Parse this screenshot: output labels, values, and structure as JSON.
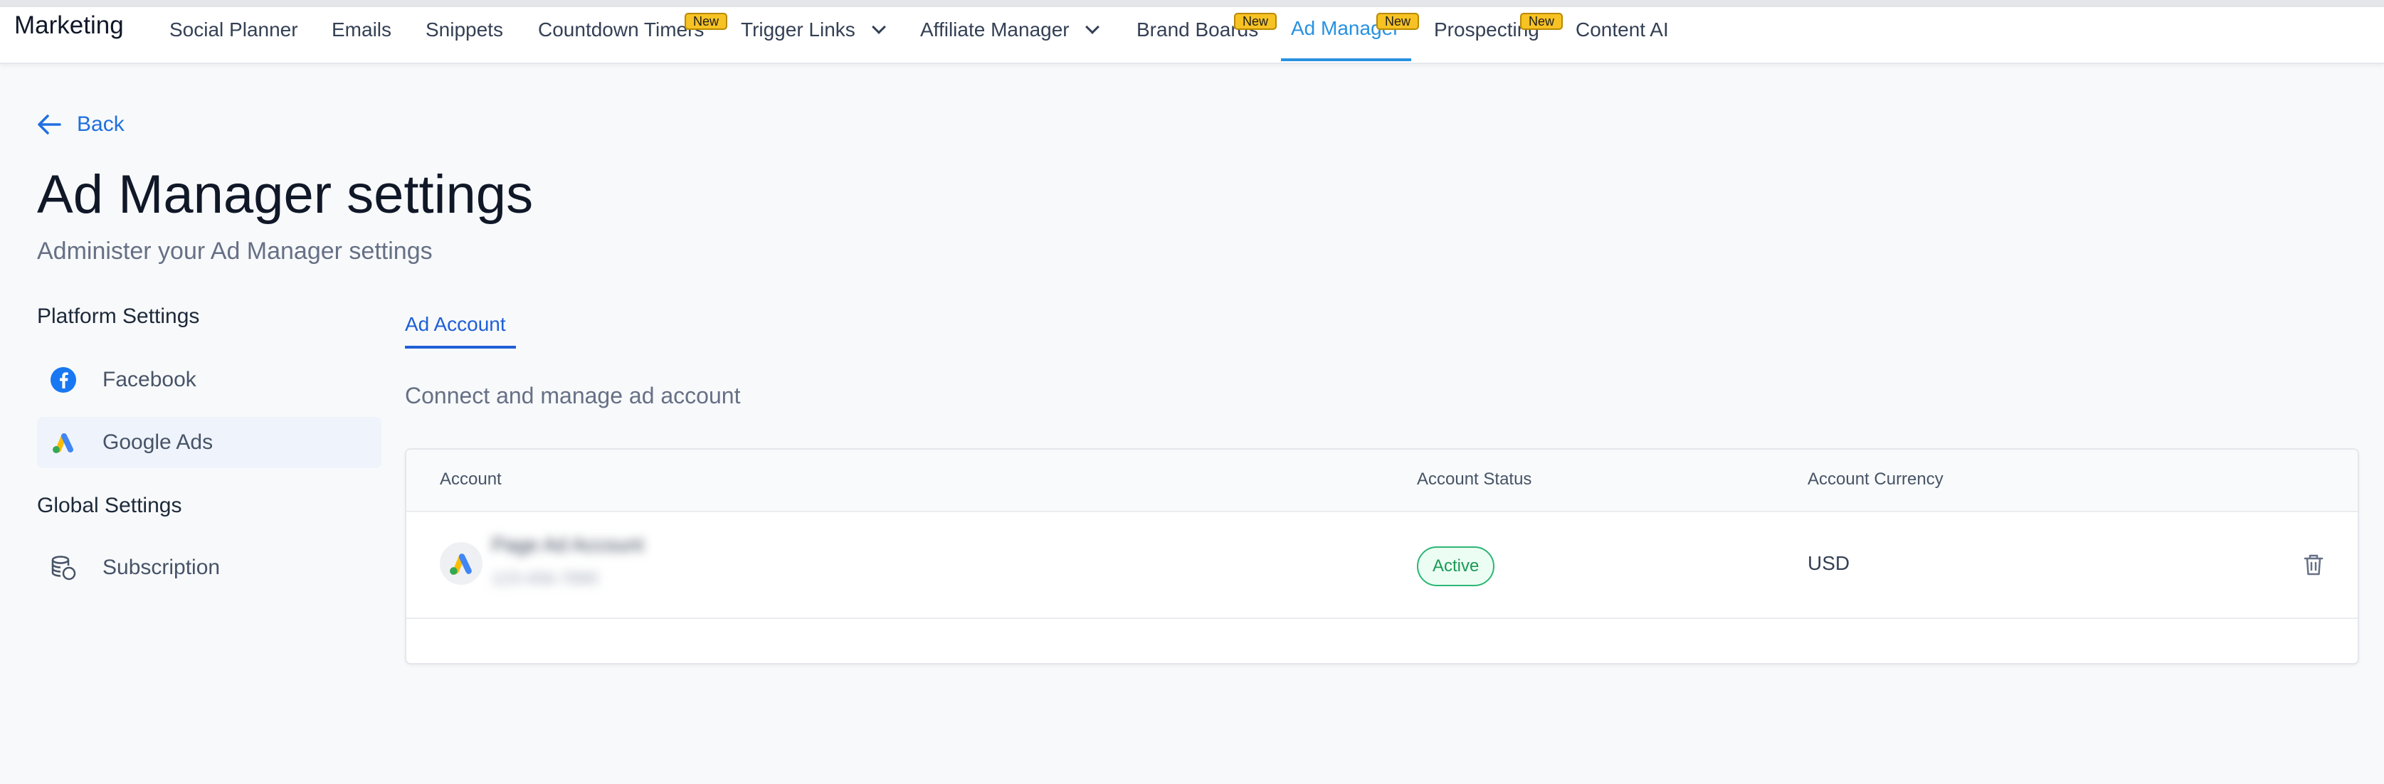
{
  "nav": {
    "brand": "Marketing",
    "items": [
      {
        "label": "Social Planner"
      },
      {
        "label": "Emails"
      },
      {
        "label": "Snippets"
      },
      {
        "label": "Countdown Timers",
        "badge": "New"
      },
      {
        "label": "Trigger Links"
      },
      {
        "label": "Affiliate Manager"
      },
      {
        "label": "Brand Boards",
        "badge": "New"
      },
      {
        "label": "Ad Manager",
        "badge": "New",
        "active": true
      },
      {
        "label": "Prospecting",
        "badge": "New"
      },
      {
        "label": "Content AI"
      }
    ],
    "accent_color": "#2891e0",
    "badge_color": "#f7c223"
  },
  "back_label": "Back",
  "page": {
    "title": "Ad Manager settings",
    "subtitle": "Administer your Ad Manager settings"
  },
  "sidebar": {
    "platform_heading": "Platform Settings",
    "platform_items": [
      {
        "label": "Facebook",
        "icon": "facebook-icon"
      },
      {
        "label": "Google Ads",
        "icon": "google-ads-icon",
        "selected": true
      }
    ],
    "global_heading": "Global Settings",
    "global_items": [
      {
        "label": "Subscription",
        "icon": "subscription-icon"
      }
    ]
  },
  "content": {
    "tab": "Ad Account",
    "description": "Connect and manage ad account",
    "table": {
      "columns": [
        "Account",
        "Account Status",
        "Account Currency"
      ],
      "rows": [
        {
          "account_name": "Page Ad Account",
          "account_id": "123-456-7890",
          "status": "Active",
          "currency": "USD"
        }
      ]
    },
    "status_color": "#1a9a56"
  }
}
